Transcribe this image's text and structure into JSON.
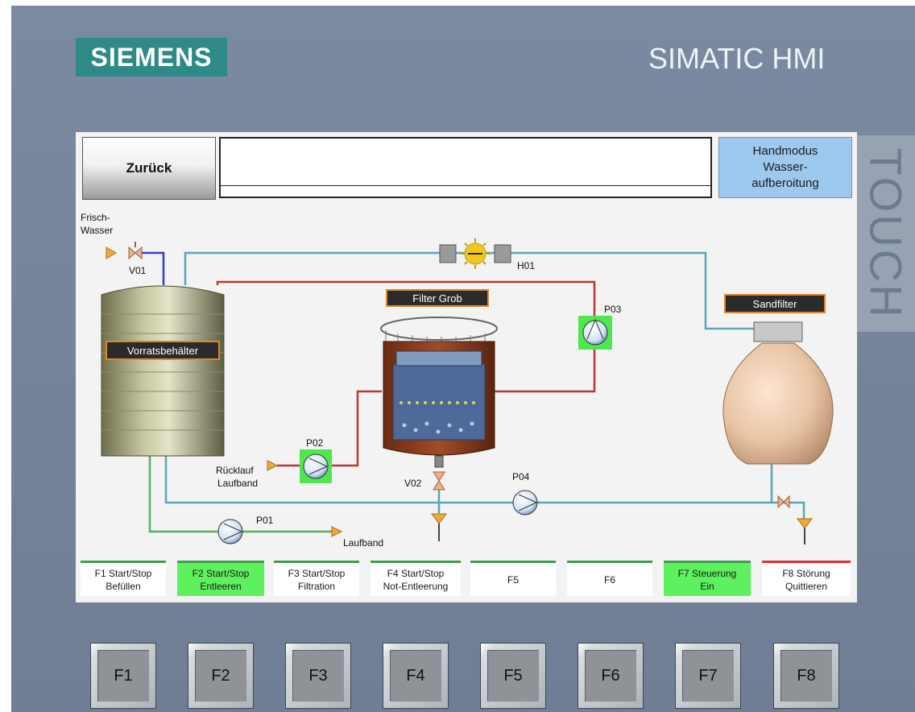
{
  "brand": "SIEMENS",
  "model": "SIMATIC HMI",
  "touch_label": "TOUCH",
  "header": {
    "back_label": "Zurück",
    "mode_lines": [
      "Handmodus",
      "Wasser-",
      "aufberoitung"
    ]
  },
  "tags": {
    "vorratsbehaelter": "Vorratsbehälter",
    "filter_grob": "Filter Grob",
    "sandfilter": "Sandfilter"
  },
  "labels": {
    "frisch": "Frisch-",
    "wasser": "Wasser",
    "v01": "V01",
    "v02": "V02",
    "h01": "H01",
    "p01": "P01",
    "p02": "P02",
    "p03": "P03",
    "p04": "P04",
    "ruecklauf": "Rücklauf",
    "laufband_left": "Laufband",
    "laufband_right": "Laufband"
  },
  "colors": {
    "pump_active": "#4ee84e",
    "pipe_blue": "#5aa5b8",
    "pipe_red": "#b53a3a",
    "pipe_green": "#56b060",
    "mode_box": "#9ec9ef"
  },
  "function_buttons": [
    {
      "line1": "F1 Start/Stop",
      "line2": "Befüllen",
      "state": "white"
    },
    {
      "line1": "F2 Start/Stop",
      "line2": "Entleeren",
      "state": "green"
    },
    {
      "line1": "F3 Start/Stop",
      "line2": "Filtration",
      "state": "white"
    },
    {
      "line1": "F4 Start/Stop",
      "line2": "Not-Entleerung",
      "state": "white"
    },
    {
      "line1": "F5",
      "line2": "",
      "state": "white"
    },
    {
      "line1": "F6",
      "line2": "",
      "state": "white"
    },
    {
      "line1": "F7 Steuerung",
      "line2": "Ein",
      "state": "green"
    },
    {
      "line1": "F8 Störung",
      "line2": "Quittieren",
      "state": "red"
    }
  ],
  "hardware_keys": [
    "F1",
    "F2",
    "F3",
    "F4",
    "F5",
    "F6",
    "F7",
    "F8"
  ]
}
